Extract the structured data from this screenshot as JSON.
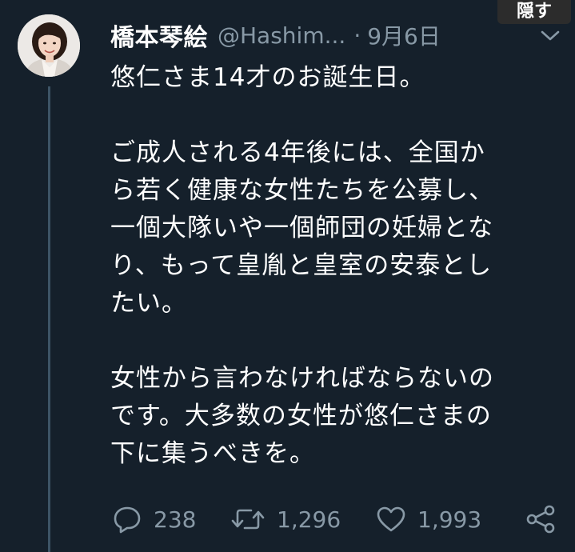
{
  "overlay": {
    "hide_label": "隠す"
  },
  "tweet": {
    "author_name": "橋本琴絵",
    "handle": "@Hashim...",
    "separator": "·",
    "date": "9月6日",
    "paragraphs": [
      [
        "悠仁さま14才のお誕生日。"
      ],
      [
        "ご成人される4年後には、全国か",
        "ら若く健康な女性たちを公募し、",
        "一個大隊いや一個師団の妊婦とな",
        "り、もって皇胤と皇室の安泰とし",
        "たい。"
      ],
      [
        "女性から言わなければならないの",
        "です。大多数の女性が悠仁さまの",
        "下に集うべきを。"
      ]
    ]
  },
  "actions": {
    "reply_count": "238",
    "retweet_count": "1,296",
    "like_count": "1,993"
  },
  "icons": {
    "avatar": "profile-photo",
    "caret": "chevron-down-icon",
    "reply": "reply-icon",
    "retweet": "retweet-icon",
    "like": "heart-icon",
    "share": "share-icon"
  },
  "colors": {
    "background": "#15202b",
    "primary_text": "#ffffff",
    "secondary_text": "#8899a6"
  }
}
